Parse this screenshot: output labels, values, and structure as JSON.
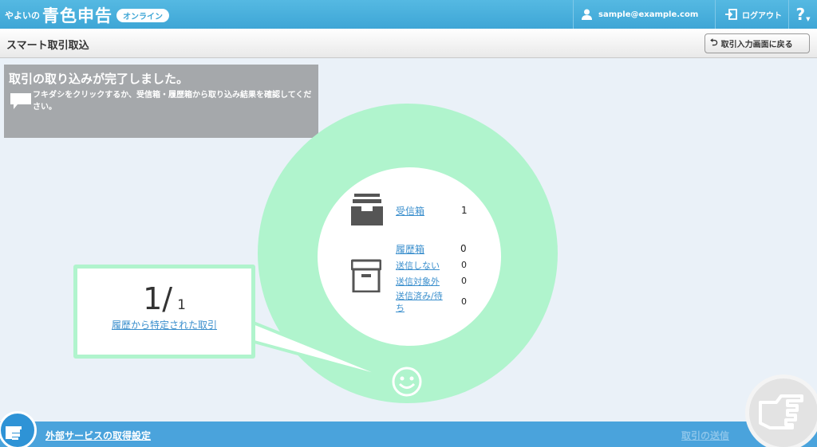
{
  "header": {
    "brand_small": "やよいの",
    "brand_main": "青色申告",
    "brand_badge": "オンライン",
    "user_email": "sample@example.com",
    "logout_label": "ログアウト",
    "help_label": "?"
  },
  "subheader": {
    "title": "スマート取引取込",
    "back_button": "取引入力画面に戻る"
  },
  "message": {
    "title": "取引の取り込みが完了しました。",
    "body": "フキダシをクリックするか、受信箱・履歴箱から取り込み結果を確認してください。"
  },
  "stats": {
    "inbox_label": "受信箱",
    "inbox_value": "1",
    "history_label": "履歴箱",
    "history_value": "0",
    "not_sent_label": "送信しない",
    "not_sent_value": "0",
    "excluded_label": "送信対象外",
    "excluded_value": "0",
    "sent_label": "送信済み/待ち",
    "sent_value": "0"
  },
  "bubble": {
    "count": "1",
    "slash": "/",
    "total": "1",
    "link": "履歴から特定された取引"
  },
  "footer": {
    "external_settings": "外部サービスの取得設定",
    "send_transactions": "取引の送信"
  },
  "colors": {
    "header_blue": "#3ea6d6",
    "mint": "#b0f4cd",
    "link_blue": "#3b8fcd",
    "footer_blue": "#4aa3dc"
  }
}
